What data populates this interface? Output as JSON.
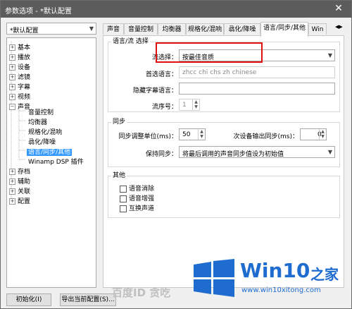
{
  "window": {
    "title": "参数选项 - *默认配置",
    "close_glyph": "✕"
  },
  "profile_select": {
    "value": "*默认配置"
  },
  "tree": [
    {
      "label": "基本",
      "expander": "+"
    },
    {
      "label": "播放",
      "expander": "+"
    },
    {
      "label": "设备",
      "expander": "+"
    },
    {
      "label": "滤镜",
      "expander": "+"
    },
    {
      "label": "字幕",
      "expander": "+"
    },
    {
      "label": "视频",
      "expander": "+"
    },
    {
      "label": "声音",
      "expander": "−"
    },
    {
      "label": "音量控制"
    },
    {
      "label": "均衡器"
    },
    {
      "label": "规格化/混响"
    },
    {
      "label": "骉化/降噪"
    },
    {
      "label": "语言/同步/其他"
    },
    {
      "label": "Winamp DSP 插件"
    },
    {
      "label": "存档",
      "expander": "+"
    },
    {
      "label": "辅助",
      "expander": "+"
    },
    {
      "label": "关联",
      "expander": "+"
    },
    {
      "label": "配置",
      "expander": "+"
    }
  ],
  "tabs": [
    "声音",
    "音量控制",
    "均衡器",
    "规格化/混响",
    "骉化/降噪",
    "语言/同步/其他",
    "Win"
  ],
  "tab_arrows": {
    "left": "◀",
    "right": "▶"
  },
  "lang_group": {
    "title": "语言/流 选择",
    "stream_label": "流选择：",
    "stream_value": "按最佳音质",
    "pref_lang_label": "首选语言：",
    "pref_lang_value": "zhcc chi chs zh chinese",
    "hidden_sub_label": "隐藏字幕语言：",
    "hidden_sub_value": "",
    "stream_no_label": "流序号：",
    "stream_no_value": "1"
  },
  "sync_group": {
    "title": "同步",
    "adjust_label": "同步调整单位(ms)：",
    "adjust_value": "50",
    "secondary_label": "次设备输出同步(ms)：",
    "secondary_value": "0",
    "keep_label": "保持同步：",
    "keep_value": "将最后调用的声音同步值设为初始值"
  },
  "other_group": {
    "title": "其他",
    "options": [
      "语音消除",
      "语音增强",
      "互换声道"
    ]
  },
  "buttons": {
    "init": "初始化(I)",
    "export": "导出当前配置(S)..."
  },
  "watermarks": {
    "baidu": "百度ID 贪吃",
    "brand_win": "Win10",
    "brand_zhi": "之家",
    "url": "www.win10xitong.com"
  },
  "colors": {
    "brand_blue": "#1e6ccf",
    "highlight_red": "#e01010",
    "selection": "#3399ff"
  }
}
